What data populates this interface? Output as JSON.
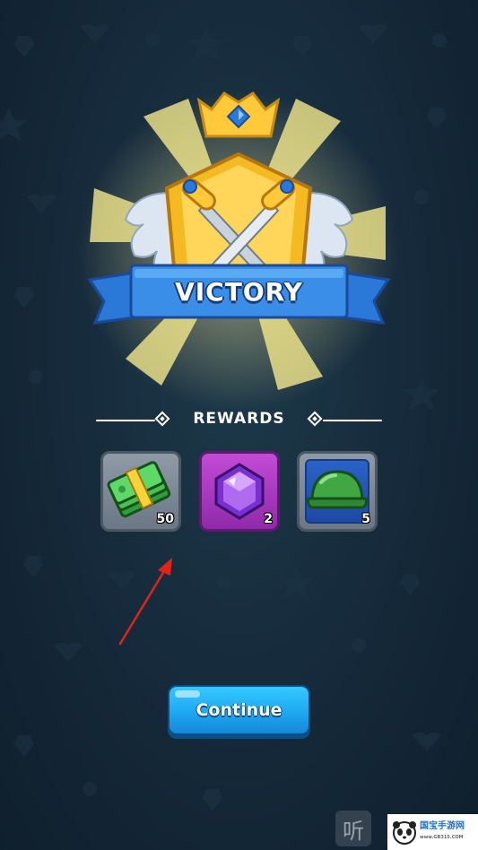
{
  "screen": {
    "banner_title": "VICTORY",
    "rewards_title": "REWARDS",
    "continue_label": "Continue"
  },
  "rewards": [
    {
      "item": "cash",
      "icon": "cash-stack-icon",
      "quantity": "50"
    },
    {
      "item": "gem",
      "icon": "purple-gem-icon",
      "quantity": "2"
    },
    {
      "item": "helmet",
      "icon": "green-helmet-icon",
      "quantity": "5"
    }
  ],
  "overlay": {
    "listen_glyph": "听",
    "watermark_text": "国宝手游网",
    "watermark_sub": "www.GB315.COM"
  },
  "colors": {
    "background": "#15293a",
    "banner_blue": "#2a78d8",
    "gold": "#ffc93a",
    "continue_blue": "#1ea8f2",
    "gem_card": "#c34bd6",
    "annotation_arrow": "#e2231a"
  }
}
